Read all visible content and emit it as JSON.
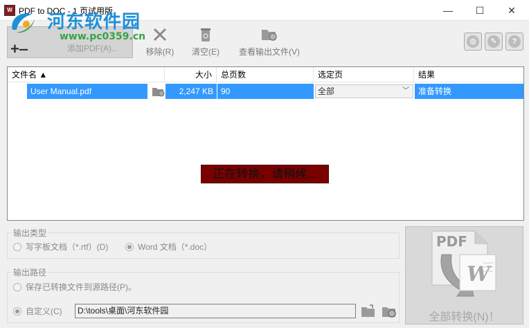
{
  "window": {
    "title": "PDF to DOC - 1 页试用版",
    "icon_text": "W",
    "minimize": "—",
    "maximize": "☐",
    "close": "✕"
  },
  "watermark": {
    "name": "河东软件园",
    "url": "www.pc0359.cn"
  },
  "toolbar": {
    "add_label": "添加PDF(A)...",
    "remove_label": "移除(R)",
    "clear_label": "清空(E)",
    "view_output_label": "查看输出文件(V)",
    "icon_buttons": [
      "globe-icon",
      "settings-icon",
      "help-icon"
    ]
  },
  "table": {
    "headers": [
      "文件名 ▲",
      "大小",
      "总页数",
      "选定页",
      "结果"
    ],
    "rows": [
      {
        "name": "User Manual.pdf",
        "size": "2,247 KB",
        "pages": "90",
        "selected": "全部",
        "result": "准备转换"
      }
    ],
    "status_message": "正在转换，请稍候..."
  },
  "output_type": {
    "title": "输出类型",
    "options": [
      "写字板文档（*.rtf）(D)",
      "Word 文档（*.doc）"
    ],
    "selected_index": 1
  },
  "output_path": {
    "title": "输出路径",
    "option_source": "保存已转换文件到源路径(P)。",
    "option_custom": "自定义(C)",
    "selected": "custom",
    "path_value": "D:\\tools\\桌面\\河东软件园"
  },
  "convert": {
    "label": "全部转换(N)！",
    "logo_text": "PDF"
  },
  "colors": {
    "selection": "#3399ff",
    "status_bg": "#7a0000"
  }
}
